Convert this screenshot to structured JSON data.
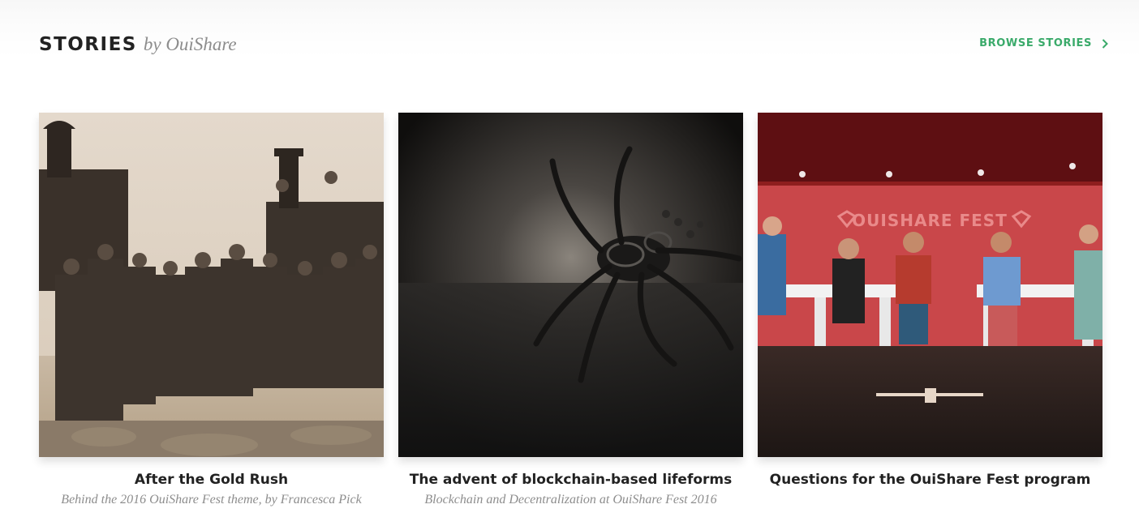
{
  "header": {
    "title": "STORIES",
    "by": "by OuiShare",
    "browse_label": "BROWSE STORIES",
    "accent_color": "#3aaa6a"
  },
  "stories": [
    {
      "title": "After the Gold Rush",
      "subtitle": "Behind the 2016 OuiShare Fest theme, by Francesca Pick",
      "image": "sepia historic photo of railroad workers and steam locomotives"
    },
    {
      "title": "The advent of blockchain-based lifeforms",
      "subtitle": "Blockchain and Decentralization at OuiShare Fest 2016",
      "image": "dark photo of a metal spider-like sculpture"
    },
    {
      "title": "Questions for the OuiShare Fest program",
      "subtitle": "",
      "image": "panel discussion on red stage",
      "stage_sign": "OUISHARE FEST"
    }
  ]
}
